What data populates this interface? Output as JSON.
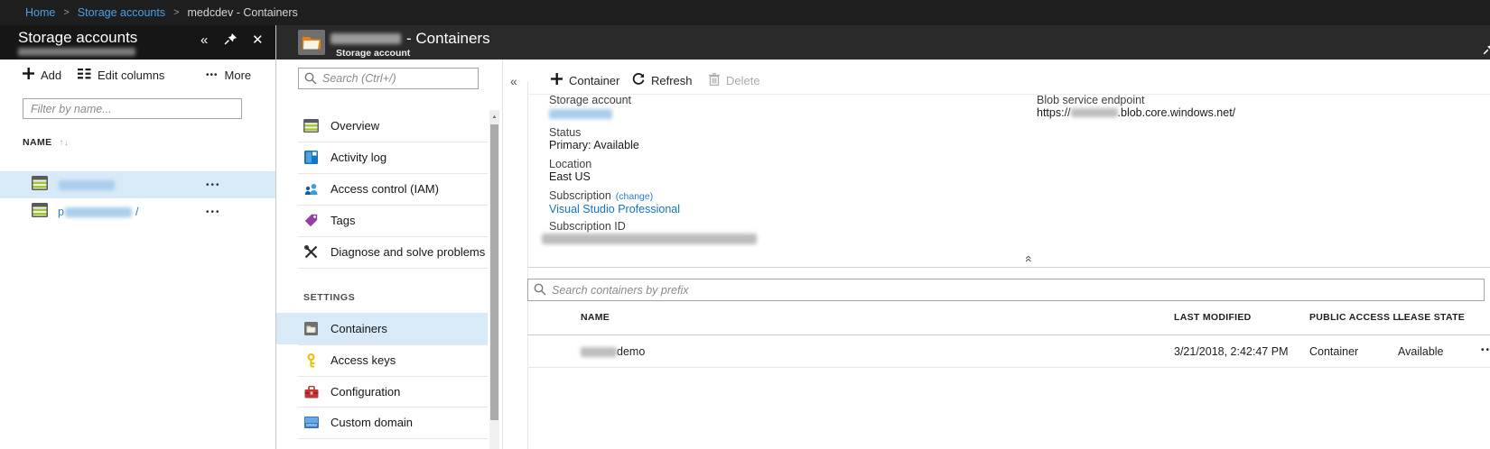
{
  "breadcrumb": {
    "home": "Home",
    "storage_accounts": "Storage accounts",
    "current": "medcdev - Containers",
    "separator": ">"
  },
  "left_panel": {
    "title": "Storage accounts",
    "subtitle_redacted": true,
    "toolbar": {
      "add": "Add",
      "edit_columns": "Edit columns",
      "more": "More"
    },
    "filter_placeholder": "Filter by name...",
    "name_header": "NAME",
    "rows": [
      {
        "redacted": true,
        "selected": true
      },
      {
        "redacted": true,
        "visible_prefix": "p",
        "visible_suffix": "/",
        "selected": false
      }
    ]
  },
  "blade_header": {
    "title_redacted": true,
    "title_suffix": "- Containers",
    "subtitle": "Storage account"
  },
  "menu": {
    "search_placeholder": "Search (Ctrl+/)",
    "items": [
      {
        "label": "Overview"
      },
      {
        "label": "Activity log"
      },
      {
        "label": "Access control (IAM)"
      },
      {
        "label": "Tags"
      },
      {
        "label": "Diagnose and solve problems"
      }
    ],
    "settings_label": "SETTINGS",
    "settings_items": [
      {
        "label": "Containers",
        "selected": true
      },
      {
        "label": "Access keys",
        "selected": false
      },
      {
        "label": "Configuration",
        "selected": false
      },
      {
        "label": "Custom domain",
        "selected": false
      }
    ]
  },
  "content": {
    "toolbar": {
      "container": "Container",
      "refresh": "Refresh",
      "delete": "Delete"
    },
    "essentials": {
      "storage_account_label": "Storage account",
      "storage_account_redacted": true,
      "status_label": "Status",
      "status_value": "Primary: Available",
      "location_label": "Location",
      "location_value": "East US",
      "subscription_label": "Subscription",
      "subscription_change": "(change)",
      "subscription_value": "Visual Studio Professional",
      "subscription_id_label": "Subscription ID",
      "subscription_id_redacted": true,
      "blob_endpoint_label": "Blob service endpoint",
      "blob_url_prefix": "https://",
      "blob_url_redacted": true,
      "blob_url_suffix": ".blob.core.windows.net/"
    },
    "container_search_placeholder": "Search containers by prefix",
    "table": {
      "headers": {
        "name": "NAME",
        "last_modified": "LAST MODIFIED",
        "public_access": "PUBLIC ACCESS L...",
        "lease_state": "LEASE STATE"
      },
      "rows": [
        {
          "name_redacted_prefix": true,
          "name_suffix": "demo",
          "last_modified": "3/21/2018, 2:42:47 PM",
          "public_access": "Container",
          "lease_state": "Available"
        }
      ]
    }
  },
  "icons": {
    "collapse_left": "«",
    "close": "✕",
    "more_dots": "•••",
    "row_ellipsis": "•••",
    "sort": "↑↓",
    "scroll_up": "▲",
    "collapse_up": "«"
  },
  "colors": {
    "breadcrumb_bg": "#1e1e1e",
    "panel_header_bg": "#161616",
    "blade_header_bg": "#2a2a2a",
    "link_blue": "#1374c2",
    "breadcrumb_link": "#4ba0e8",
    "selected_bg": "#d8eaf8"
  }
}
